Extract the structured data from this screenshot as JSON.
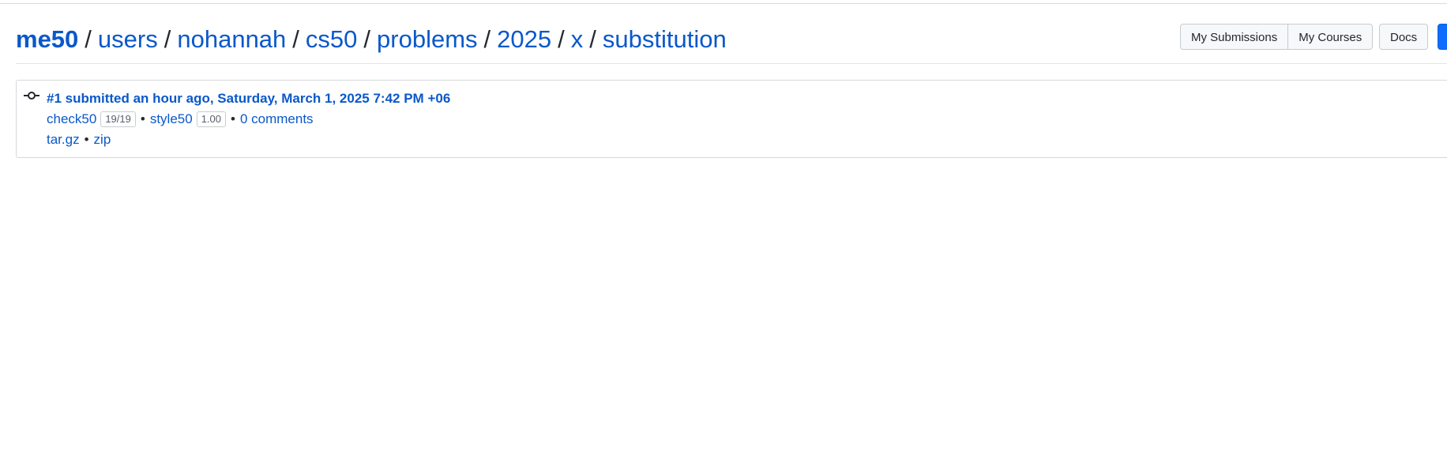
{
  "breadcrumb": {
    "root": "me50",
    "segments": [
      "users",
      "nohannah",
      "cs50",
      "problems",
      "2025",
      "x",
      "substitution"
    ],
    "separator": "/"
  },
  "toolbar": {
    "my_submissions": "My Submissions",
    "my_courses": "My Courses",
    "docs": "Docs"
  },
  "submission": {
    "title": "#1 submitted an hour ago, Saturday, March 1, 2025 7:42 PM +06",
    "check50_label": "check50",
    "check50_score": "19/19",
    "style50_label": "style50",
    "style50_score": "1.00",
    "comments": "0 comments",
    "bullet": "•",
    "download_targz": "tar.gz",
    "download_zip": "zip"
  },
  "colors": {
    "link": "#0a58ca",
    "primary_button": "#0d6efd"
  }
}
